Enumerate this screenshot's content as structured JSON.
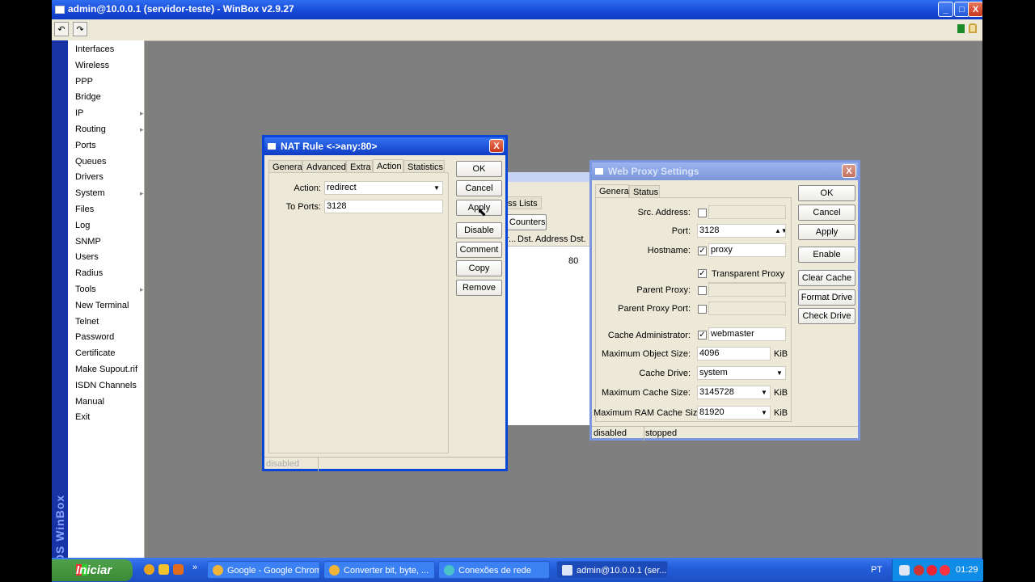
{
  "window": {
    "title": "admin@10.0.0.1 (servidor-teste) - WinBox v2.9.27",
    "minimize": "_",
    "maximize": "□",
    "close": "X"
  },
  "toolbar": {
    "undo": "↶",
    "redo": "↷"
  },
  "brand": "RouterOS WinBox",
  "sidebar": {
    "items": [
      {
        "label": "Interfaces",
        "submenu": false
      },
      {
        "label": "Wireless",
        "submenu": false
      },
      {
        "label": "PPP",
        "submenu": false
      },
      {
        "label": "Bridge",
        "submenu": false
      },
      {
        "label": "IP",
        "submenu": true
      },
      {
        "label": "Routing",
        "submenu": true
      },
      {
        "label": "Ports",
        "submenu": false
      },
      {
        "label": "Queues",
        "submenu": false
      },
      {
        "label": "Drivers",
        "submenu": false
      },
      {
        "label": "System",
        "submenu": true
      },
      {
        "label": "Files",
        "submenu": false
      },
      {
        "label": "Log",
        "submenu": false
      },
      {
        "label": "SNMP",
        "submenu": false
      },
      {
        "label": "Users",
        "submenu": false
      },
      {
        "label": "Radius",
        "submenu": false
      },
      {
        "label": "Tools",
        "submenu": true
      },
      {
        "label": "New Terminal",
        "submenu": false
      },
      {
        "label": "Telnet",
        "submenu": false
      },
      {
        "label": "Password",
        "submenu": false
      },
      {
        "label": "Certificate",
        "submenu": false
      },
      {
        "label": "Make Supout.rif",
        "submenu": false
      },
      {
        "label": "ISDN Channels",
        "submenu": false
      },
      {
        "label": "Manual",
        "submenu": false
      },
      {
        "label": "Exit",
        "submenu": false
      }
    ]
  },
  "nat_rule": {
    "title": "NAT Rule <->any:80>",
    "tabs": [
      "General",
      "Advanced",
      "Extra",
      "Action",
      "Statistics"
    ],
    "action_label": "Action:",
    "action_value": "redirect",
    "to_ports_label": "To Ports:",
    "to_ports_value": "3128",
    "buttons": [
      "OK",
      "Cancel",
      "Apply",
      "Disable",
      "Comment",
      "Copy",
      "Remove"
    ],
    "status": "disabled"
  },
  "firewall_behind": {
    "tab_lists": "ss Lists",
    "counters": "l Counters",
    "col_r": "r...",
    "col_dst_address": "Dst. Address",
    "col_dst": "Dst.",
    "row_port": "80"
  },
  "web_proxy": {
    "title": "Web Proxy Settings",
    "tabs": [
      "General",
      "Status"
    ],
    "src_address_label": "Src. Address:",
    "port_label": "Port:",
    "port_value": "3128",
    "hostname_label": "Hostname:",
    "hostname_value": "proxy",
    "transparent_label": "Transparent Proxy",
    "parent_proxy_label": "Parent Proxy:",
    "parent_proxy_port_label": "Parent Proxy Port:",
    "cache_admin_label": "Cache Administrator:",
    "cache_admin_value": "webmaster",
    "max_object_label": "Maximum Object Size:",
    "max_object_value": "4096",
    "cache_drive_label": "Cache Drive:",
    "cache_drive_value": "system",
    "max_cache_label": "Maximum Cache Size:",
    "max_cache_value": "3145728",
    "max_ram_label": "Maximum RAM Cache Size:",
    "max_ram_value": "81920",
    "unit": "KiB",
    "check_mark": "✓",
    "buttons": [
      "OK",
      "Cancel",
      "Apply",
      "Enable",
      "Clear Cache",
      "Format Drive",
      "Check Drive"
    ],
    "status_left": "disabled",
    "status_right": "stopped"
  },
  "taskbar": {
    "start": "Iniciar",
    "more": "»",
    "items": [
      "Google - Google Chrome",
      "Converter bit, byte, ...",
      "Conexões de rede",
      "admin@10.0.0.1 (ser..."
    ],
    "lang": "PT",
    "clock": "01:29"
  }
}
